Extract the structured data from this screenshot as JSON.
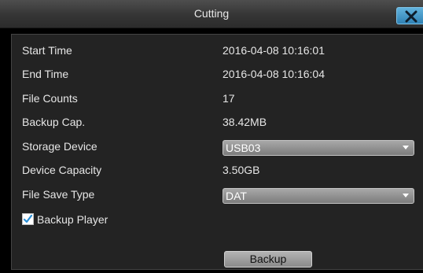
{
  "dialog": {
    "title": "Cutting",
    "close_icon": "close-icon"
  },
  "fields": {
    "start_time": {
      "label": "Start Time",
      "value": "2016-04-08 10:16:01"
    },
    "end_time": {
      "label": "End Time",
      "value": "2016-04-08 10:16:04"
    },
    "file_counts": {
      "label": "File Counts",
      "value": "17"
    },
    "backup_cap": {
      "label": "Backup Cap.",
      "value": "38.42MB"
    },
    "storage_device": {
      "label": "Storage Device",
      "selected": "USB03"
    },
    "device_capacity": {
      "label": "Device Capacity",
      "value": "3.50GB"
    },
    "file_save_type": {
      "label": "File Save Type",
      "selected": "DAT"
    }
  },
  "backup_player": {
    "label": "Backup Player",
    "checked": true
  },
  "actions": {
    "backup_label": "Backup"
  },
  "colors": {
    "accent": "#3a8fc4",
    "panel": "#232323",
    "text": "#e6e6e6"
  }
}
